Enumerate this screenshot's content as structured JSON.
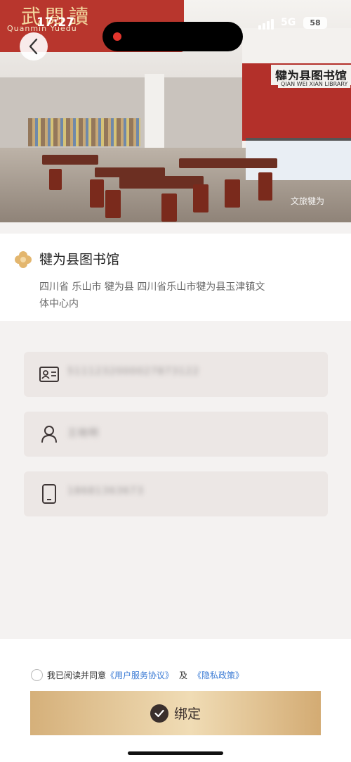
{
  "status_bar": {
    "time": "17:27",
    "network": "5G",
    "battery": "58"
  },
  "hero": {
    "banner_text": "武閱讀",
    "banner_sub": "Quanmin  Yuedu",
    "sign_text": "犍为县图书馆",
    "sign_sub": "QIAN WEI XIAN LIBRARY",
    "watermark": "文旅犍为"
  },
  "library": {
    "name": "犍为县图书馆",
    "address": "四川省 乐山市 犍为县 四川省乐山市犍为县玉津镇文体中心内"
  },
  "form": {
    "id_value": "5111232000027873122",
    "name_value": "王晓明",
    "phone_value": "18681363673"
  },
  "agreement": {
    "prefix": "我已阅读并同意",
    "service_link": "《用户服务协议》",
    "connector": "及",
    "privacy_link": "《隐私政策》"
  },
  "submit": {
    "label": "绑定"
  },
  "colors": {
    "accent_gold": "#e2c597",
    "link_blue": "#3b7bd5",
    "dark": "#3a2f2c"
  }
}
